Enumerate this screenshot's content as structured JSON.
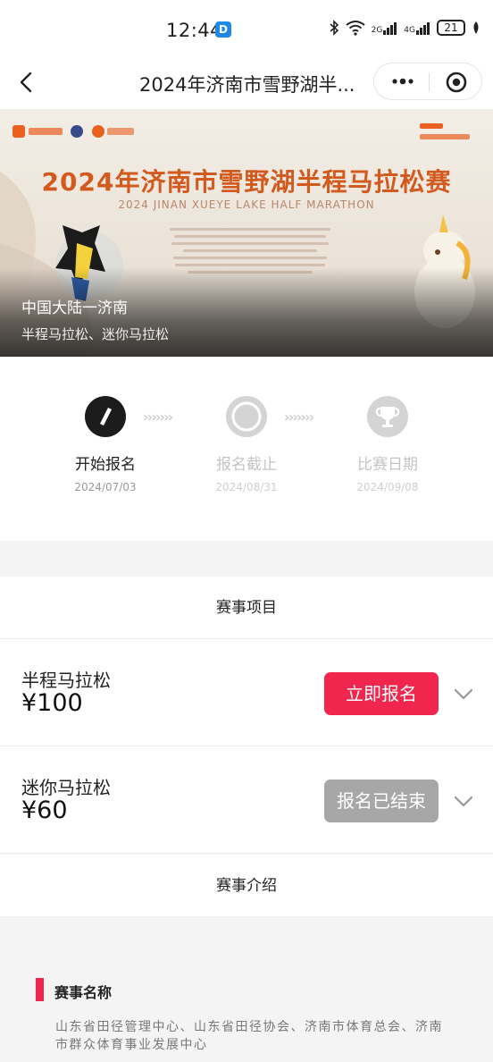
{
  "status_bar": {
    "time": "12:44",
    "app_badge": "D",
    "network_1": "2G",
    "network_2": "4G",
    "battery": "21"
  },
  "nav": {
    "title": "2024年济南市雪野湖半..."
  },
  "banner": {
    "title": "2024年济南市雪野湖半程马拉松赛",
    "subtitle": "2024 JINAN XUEYE LAKE HALF MARATHON",
    "location": "中国大陆一济南",
    "event_types": "半程马拉松、迷你马拉松"
  },
  "timeline": {
    "steps": [
      {
        "label": "开始报名",
        "date": "2024/07/03",
        "state": "active"
      },
      {
        "label": "报名截止",
        "date": "2024/08/31",
        "state": "inactive"
      },
      {
        "label": "比赛日期",
        "date": "2024/09/08",
        "state": "inactive"
      }
    ]
  },
  "events_section": {
    "heading": "赛事项目",
    "items": [
      {
        "name": "半程马拉松",
        "price": "¥100",
        "button": "立即报名",
        "status": "open"
      },
      {
        "name": "迷你马拉松",
        "price": "¥60",
        "button": "报名已结束",
        "status": "closed"
      }
    ]
  },
  "intro_section": {
    "heading": "赛事介绍",
    "subheading": "赛事名称",
    "content": "山东省田径管理中心、山东省田径协会、济南市体育总会、济南市群众体育事业发展中心"
  },
  "colors": {
    "accent": "#f0264e",
    "disabled": "#a7a7a7",
    "active_step": "#1c1c1c"
  }
}
